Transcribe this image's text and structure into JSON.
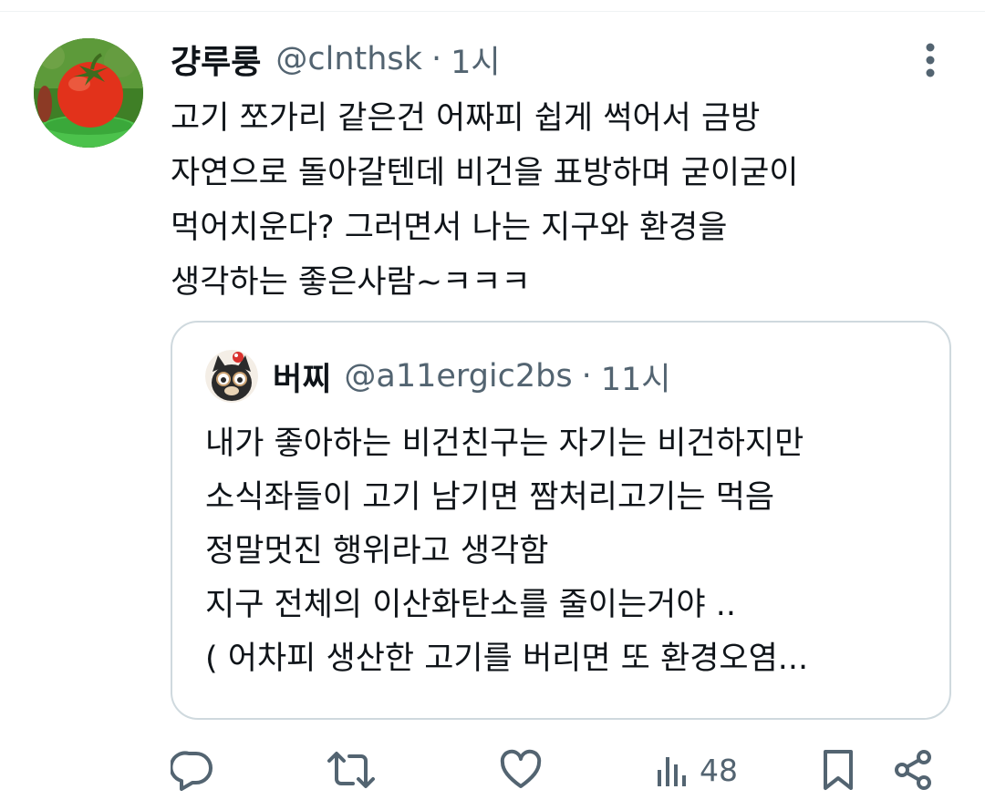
{
  "tweet": {
    "display_name": "걍루룽",
    "handle": "@clnthsk",
    "separator": "·",
    "time": "1시",
    "avatar_icon": "tomato-avatar",
    "text_lines": [
      "고기 쪼가리 같은건 어짜피 쉽게 썩어서 금방",
      "자연으로 돌아갈텐데 비건을 표방하며 굳이굳이",
      "먹어치운다? 그러면서 나는 지구와 환경을",
      "생각하는 좋은사람~ㅋㅋㅋ"
    ]
  },
  "quoted": {
    "display_name": "버찌",
    "handle": "@a11ergic2bs",
    "separator": "·",
    "time": "11시",
    "avatar_icon": "cat-cartoon-avatar",
    "text_lines": [
      "내가 좋아하는 비건친구는 자기는 비건하지만",
      "소식좌들이 고기 남기면 짬처리고기는 먹음",
      "정말멋진 행위라고 생각함",
      "지구 전체의 이산화탄소를 줄이는거야 ..",
      "( 어차피 생산한 고기를 버리면 또 환경오염..."
    ]
  },
  "actions": {
    "reply_icon": "reply-icon",
    "retweet_icon": "retweet-icon",
    "like_icon": "heart-icon",
    "views_icon": "views-icon",
    "views_count": "48",
    "bookmark_icon": "bookmark-icon",
    "share_icon": "share-icon"
  },
  "colors": {
    "text_primary": "#0f1419",
    "text_secondary": "#536471",
    "border": "#cfd9de",
    "divider": "#eff3f4"
  }
}
